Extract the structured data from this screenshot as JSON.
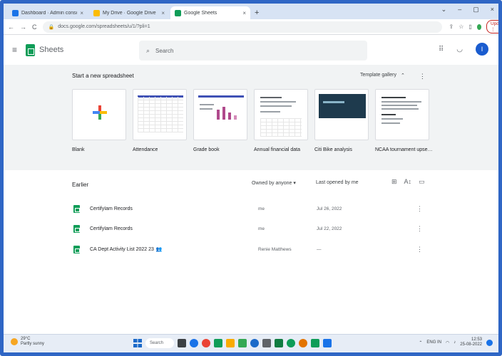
{
  "browser": {
    "tabs": [
      {
        "title": "Dashboard · Admin console",
        "active": false,
        "icon_color": "#1a73e8"
      },
      {
        "title": "My Drive · Google Drive",
        "active": false,
        "icon_color": "#fbbc04"
      },
      {
        "title": "Google Sheets",
        "active": true,
        "icon_color": "#0f9d58"
      }
    ],
    "tab_close": "×",
    "new_tab": "+",
    "window_controls": [
      "⌄",
      "–",
      "▢",
      "×"
    ],
    "url": "docs.google.com/spreadsheets/u/1/?pli=1",
    "profile_label": "Update ⋮"
  },
  "app": {
    "name": "Sheets",
    "search_placeholder": "Search",
    "avatar_initial": "I"
  },
  "templates": {
    "heading": "Start a new spreadsheet",
    "gallery_label": "Template gallery",
    "gallery_toggle": "⌃",
    "more": "⋮",
    "items": [
      {
        "label": "Blank"
      },
      {
        "label": "Attendance"
      },
      {
        "label": "Grade book"
      },
      {
        "label": "Annual financial data"
      },
      {
        "label": "Citi Bike analysis"
      },
      {
        "label": "NCAA tournament upse…"
      }
    ]
  },
  "files": {
    "section_label": "Earlier",
    "owner_filter": "Owned by anyone ▾",
    "sort_label": "Last opened by me",
    "view_icons": [
      "⊞",
      "A↕",
      "▭"
    ],
    "rows": [
      {
        "name": "CertifyIam Records",
        "owner": "me",
        "date": "Jul 26, 2022",
        "shared": false
      },
      {
        "name": "CertifyIam Records",
        "owner": "me",
        "date": "Jul 22, 2022",
        "shared": false
      },
      {
        "name": "CA Dept Activity List 2022 23",
        "owner": "Renie Matthews",
        "date": "—",
        "shared": true
      }
    ]
  },
  "taskbar": {
    "weather_temp": "29°C",
    "weather_desc": "Partly sunny",
    "search_label": "Search",
    "language": "ENG IN",
    "time": "12:53",
    "date": "25-08-2022",
    "app_colors": [
      "#3c4043",
      "#1a73e8",
      "#ea4335",
      "#0f9d58",
      "#f9ab00",
      "#34a853",
      "#1b6ac9",
      "#5f6368",
      "#107c41",
      "#0f9d58",
      "#e37400",
      "#0f9d58",
      "#1a73e8"
    ]
  }
}
